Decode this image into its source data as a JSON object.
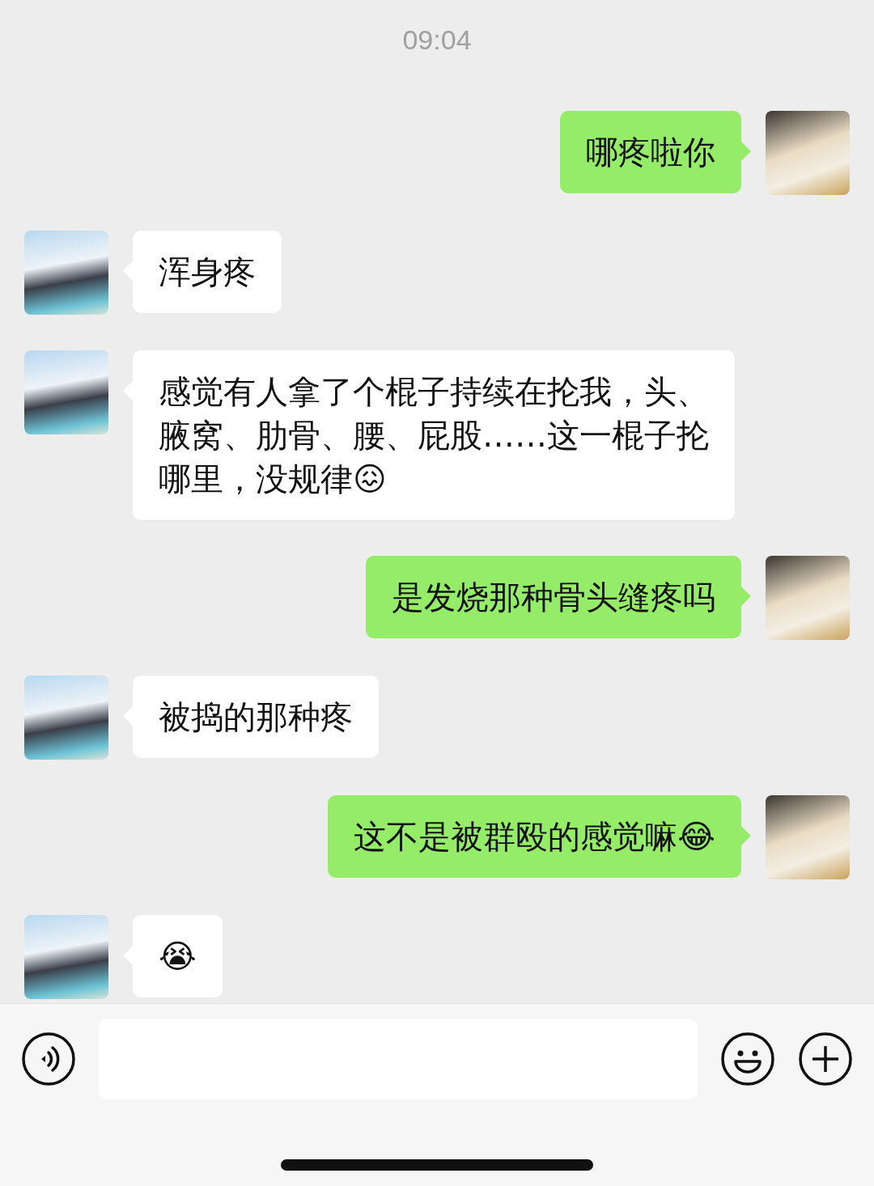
{
  "timestamp": "09:04",
  "messages": [
    {
      "kind": "sent",
      "text": "哪疼啦你"
    },
    {
      "kind": "received",
      "text": "浑身疼"
    },
    {
      "kind": "received",
      "text": "感觉有人拿了个棍子持续在抡我，头、腋窝、肋骨、腰、屁股……这一棍子抡哪里，没规律😖"
    },
    {
      "kind": "sent",
      "text": "是发烧那种骨头缝疼吗"
    },
    {
      "kind": "received",
      "text": "被捣的那种疼"
    },
    {
      "kind": "sent",
      "text": "这不是被群殴的感觉嘛😂"
    },
    {
      "kind": "received",
      "text": "😭"
    }
  ]
}
